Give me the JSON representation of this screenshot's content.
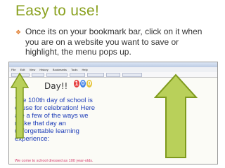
{
  "slide": {
    "title": "Easy to use!",
    "bullet_text": "Once its on your bookmark bar, click on it when you are on a website you want to save or highlight, the menu pops up."
  },
  "screenshot": {
    "menu_items": [
      "File",
      "Edit",
      "View",
      "History",
      "Bookmarks",
      "Tools",
      "Help"
    ],
    "heading_fragment": "Day!!",
    "block_text": "The 100th day of school is cause for celebration! Here are a few of the ways we make that day an unforgettable learning experience:",
    "pink_line": "We come to school dressed as 100 year-olds."
  },
  "colors": {
    "title": "#8aa11f",
    "bullet": "#e07a2a",
    "arrow_fill": "#b9d05a",
    "arrow_stroke": "#7f9a1e",
    "page_text": "#1e3db8"
  },
  "icons": [
    "bullet-diamond-icon",
    "up-arrow-icon",
    "logo-100-icon"
  ]
}
